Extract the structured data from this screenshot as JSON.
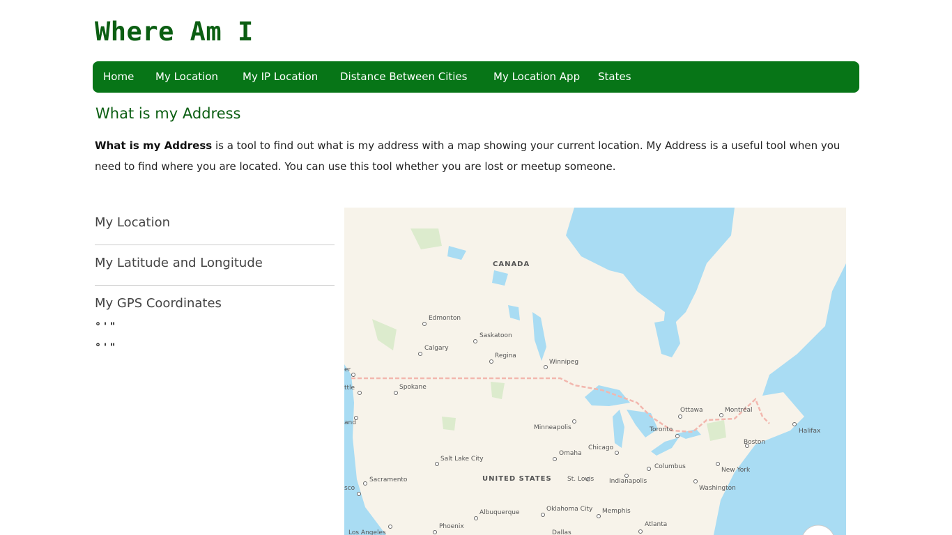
{
  "header": {
    "site_title": "Where Am I"
  },
  "nav": {
    "items": [
      {
        "label": "Home"
      },
      {
        "label": "My Location"
      },
      {
        "label": "My IP Location"
      },
      {
        "label": "Distance Between Cities"
      },
      {
        "label": "My Location App"
      },
      {
        "label": "States"
      }
    ]
  },
  "main": {
    "heading": "What is my Address",
    "intro_bold": "What is my Address",
    "intro_text": " is a tool to find out what is my address with a map showing your current location. My Address is a useful tool when you need to find where you are located. You can use this tool whether you are lost or meetup someone."
  },
  "sidebar": {
    "items": [
      {
        "label": "My Location"
      },
      {
        "label": "My Latitude and Longitude"
      },
      {
        "label": "My GPS Coordinates"
      }
    ],
    "coordinates": [
      "° ' \"",
      "° ' \""
    ]
  },
  "map": {
    "countries": [
      "CANADA",
      "UNITED STATES"
    ],
    "cities": [
      "Edmonton",
      "Saskatoon",
      "Calgary",
      "Regina",
      "Winnipeg",
      "Spokane",
      "Minneapolis",
      "Ottawa",
      "Montréal",
      "Toronto",
      "Halifax",
      "Boston",
      "Chicago",
      "Omaha",
      "Salt Lake City",
      "Columbus",
      "New York",
      "Sacramento",
      "St. Louis",
      "Indianapolis",
      "Washington",
      "Albuquerque",
      "Oklahoma City",
      "Memphis",
      "Phoenix",
      "Atlanta",
      "Los Angeles",
      "Dallas"
    ],
    "partial_labels": [
      "er",
      "ttle",
      "and",
      "sco"
    ],
    "colors": {
      "land": "#f7f3ea",
      "water": "#a9dcf3",
      "park": "#dcebcd",
      "border": "#f2b7ae"
    }
  }
}
